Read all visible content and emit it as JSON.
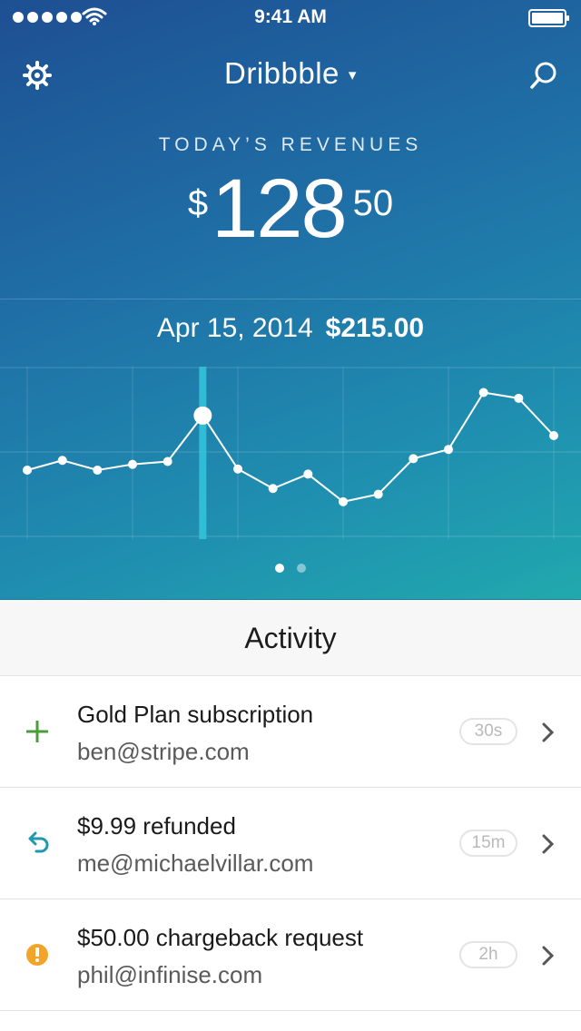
{
  "status_bar": {
    "time": "9:41 AM"
  },
  "nav": {
    "account_name": "Dribbble",
    "caret": "▾"
  },
  "revenue": {
    "label": "TODAY’S REVENUES",
    "currency_symbol": "$",
    "whole": "128",
    "cents": "50"
  },
  "selected_point": {
    "date": "Apr 15, 2014",
    "value": "$215.00"
  },
  "chart_data": {
    "type": "line",
    "title": "",
    "xlabel": "",
    "ylabel": "",
    "x": [
      0,
      1,
      2,
      3,
      4,
      5,
      6,
      7,
      8,
      9,
      10,
      11,
      12,
      13,
      14,
      15
    ],
    "series": [
      {
        "values": [
          120,
          137,
          120,
          130,
          135,
          215,
          122,
          88,
          113,
          65,
          78,
          140,
          156,
          255,
          245,
          180
        ]
      }
    ],
    "selected_index": 5,
    "ylim": [
      0,
      300
    ],
    "grid": true
  },
  "pager": {
    "pages": 2,
    "active": 0
  },
  "activity": {
    "title": "Activity",
    "items": [
      {
        "icon": "plus-icon",
        "primary": "Gold Plan subscription",
        "secondary": "ben@stripe.com",
        "badge": "30s",
        "color": "#4a9e3a"
      },
      {
        "icon": "undo-arrow-icon",
        "primary": "$9.99 refunded",
        "secondary": "me@michaelvillar.com",
        "badge": "15m",
        "color": "#1f9aac"
      },
      {
        "icon": "warning-icon",
        "primary": "$50.00 chargeback request",
        "secondary": "phil@infinise.com",
        "badge": "2h",
        "color": "#f2a428"
      }
    ]
  },
  "colors": {
    "hero_top": "#1e4f93",
    "hero_bottom": "#21a9ae",
    "highlight_bar": "#35c6dc"
  }
}
